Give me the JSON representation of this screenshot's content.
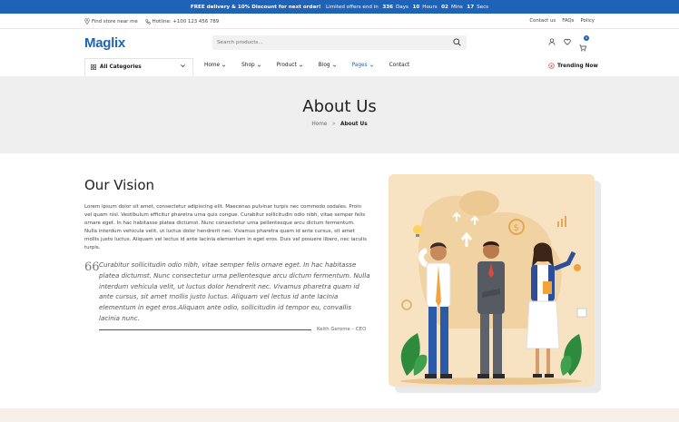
{
  "promo": {
    "part1": "FREE delivery & 10% Discount for next order!",
    "part2": "Limited offers end in",
    "days_num": "336",
    "days_label": "Days",
    "hours_num": "10",
    "hours_label": "Hours",
    "mins_num": "02",
    "mins_label": "Mins",
    "secs_num": "17",
    "secs_label": "Secs"
  },
  "util": {
    "store": "Find store near me",
    "hotline": "Hotline: +100 123 456 789",
    "links": [
      "Contact us",
      "FAQs",
      "Policy"
    ]
  },
  "header": {
    "logo": "Maglix",
    "search_placeholder": "Search products...",
    "cart_count": "0"
  },
  "nav": {
    "categories": "All Categories",
    "items": [
      {
        "label": "Home",
        "dropdown": true
      },
      {
        "label": "Shop",
        "dropdown": true
      },
      {
        "label": "Product",
        "dropdown": true
      },
      {
        "label": "Blog",
        "dropdown": true
      },
      {
        "label": "Pages",
        "dropdown": true,
        "active": true
      },
      {
        "label": "Contact",
        "dropdown": false
      }
    ],
    "trending": "Trending Now"
  },
  "hero": {
    "title": "About Us",
    "crumb_home": "Home",
    "crumb_sep": ">",
    "crumb_current": "About Us"
  },
  "vision": {
    "title": "Our Vision",
    "body": "Lorem ipsum dolor sit amet, consectetur adipiscing elit. Maecenas pulvinar turpis nec commodo sodales. Proin vel quam nisl. Vestibulum efficitur pharetra urna quis congue. Curabitur sollicitudin odio nibh, vitae semper felis ornare eget. In hac habitasse platea dictumst. Nunc consectetur urna pellentesque arcu dictum fermentum. Nulla interdum vehicula velit, ut luctus dolor hendrerit nec. Vivamus pharetra quam id ante cursus, sit amet mollis justo luctus. Aliquam vel lectus id ante lacinia elementum in eget eros. Duis vel posuere libero, nec iaculis turpis.",
    "quote_mark": "66",
    "quote": "Curabitur sollicitudin odio nibh, vitae semper felis ornare eget. In hac habitasse platea dictumst. Nunc consectetur urna pellentesque arcu dictum fermentum. Nulla interdum vehicula velit, ut luctus dolor hendrerit nec. Vivamus pharetra quam id ante cursus, sit amet mollis justo luctus. Aliquam vel lectus id ante lacinia elementum in eget eros.Aliquam ante odio, sollicitudin id tempor eu, convallis lacinia nunc.",
    "author": "Keith Gerome – CEO"
  },
  "colors": {
    "brand": "#1e63b8",
    "illustration_bg": "#f7e3c2",
    "hero_bg": "#efefef"
  }
}
